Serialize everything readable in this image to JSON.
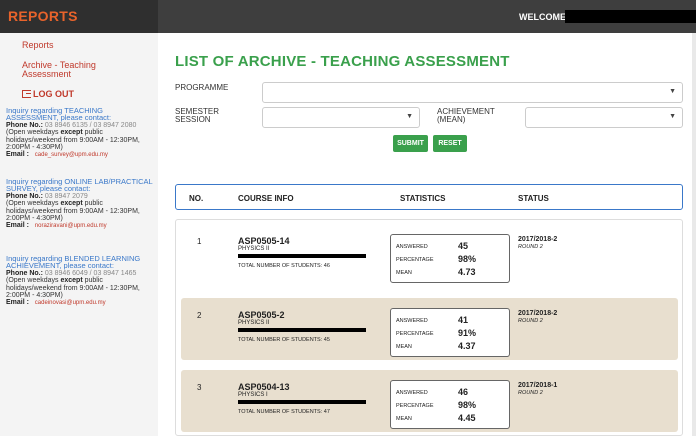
{
  "header": {
    "brand": "REPORTS",
    "welcome": "WELCOME"
  },
  "sidebar": {
    "reports": "Reports",
    "archive": "Archive - Teaching Assessment",
    "logout": "LOG OUT",
    "blocks": [
      {
        "title": "Inquiry regarding TEACHING ASSESSMENT, please contact:",
        "phone_label": "Phone No.:",
        "phone": "03 8946 6135 / 03 8947 2080",
        "hours_pre": "(Open weekdays ",
        "hours_bold": "except",
        "hours_post": " public holidays/weekend from 9:00AM - 12:30PM, 2:00PM - 4:30PM)",
        "email_label": "Email :",
        "email": "cade_survey@upm.edu.my"
      },
      {
        "title": "Inquiry regarding ONLINE LAB/PRACTICAL SURVEY, please contact:",
        "phone_label": "Phone No.:",
        "phone": "03 8947 2079",
        "hours_pre": "(Open weekdays ",
        "hours_bold": "except",
        "hours_post": " public holidays/weekend from 9:00AM - 12:30PM, 2:00PM - 4:30PM)",
        "email_label": "Email :",
        "email": "noraziravani@upm.edu.my"
      },
      {
        "title": "Inquiry regarding BLENDED LEARNING ACHIEVEMENT, please contact:",
        "phone_label": "Phone No.:",
        "phone": "03 8946 6049 / 03 8947 1465",
        "hours_pre": "(Open weekdays ",
        "hours_bold": "except",
        "hours_post": " public holidays/weekend from 9:00AM - 12:30PM, 2:00PM - 4:30PM)",
        "email_label": "Email :",
        "email": "cadeinovasi@upm.edu.my"
      }
    ]
  },
  "main": {
    "title": "LIST OF ARCHIVE - TEACHING ASSESSMENT",
    "programme_label": "PROGRAMME",
    "semester_label": "SEMESTER SESSION",
    "achievement_label": "ACHIEVEMENT (MEAN)",
    "submit": "SUBMIT",
    "reset": "RESET",
    "columns": [
      "NO.",
      "COURSE INFO",
      "STATISTICS",
      "STATUS"
    ],
    "stat_labels": {
      "answered": "ANSWERED",
      "percentage": "PERCENTAGE",
      "mean": "MEAN"
    },
    "rows": [
      {
        "no": "1",
        "code": "ASP0505-14",
        "subject": "PHYSICS II",
        "total": "TOTAL NUMBER OF STUDENTS: 46",
        "answered": "45",
        "percentage": "98%",
        "mean": "4.73",
        "session": "2017/2018-2",
        "round": "ROUND 2"
      },
      {
        "no": "2",
        "code": "ASP0505-2",
        "subject": "PHYSICS II",
        "total": "TOTAL NUMBER OF STUDENTS: 45",
        "answered": "41",
        "percentage": "91%",
        "mean": "4.37",
        "session": "2017/2018-2",
        "round": "ROUND 2"
      },
      {
        "no": "3",
        "code": "ASP0504-13",
        "subject": "PHYSICS I",
        "total": "TOTAL NUMBER OF STUDENTS: 47",
        "answered": "46",
        "percentage": "98%",
        "mean": "4.45",
        "session": "2017/2018-1",
        "round": "ROUND 2"
      }
    ]
  },
  "colors": {
    "accent_green": "#3aa04c",
    "brand_orange": "#e8632b",
    "link_red": "#c0392b",
    "link_blue": "#3a78c9",
    "row_alt": "#e8dfcf"
  }
}
